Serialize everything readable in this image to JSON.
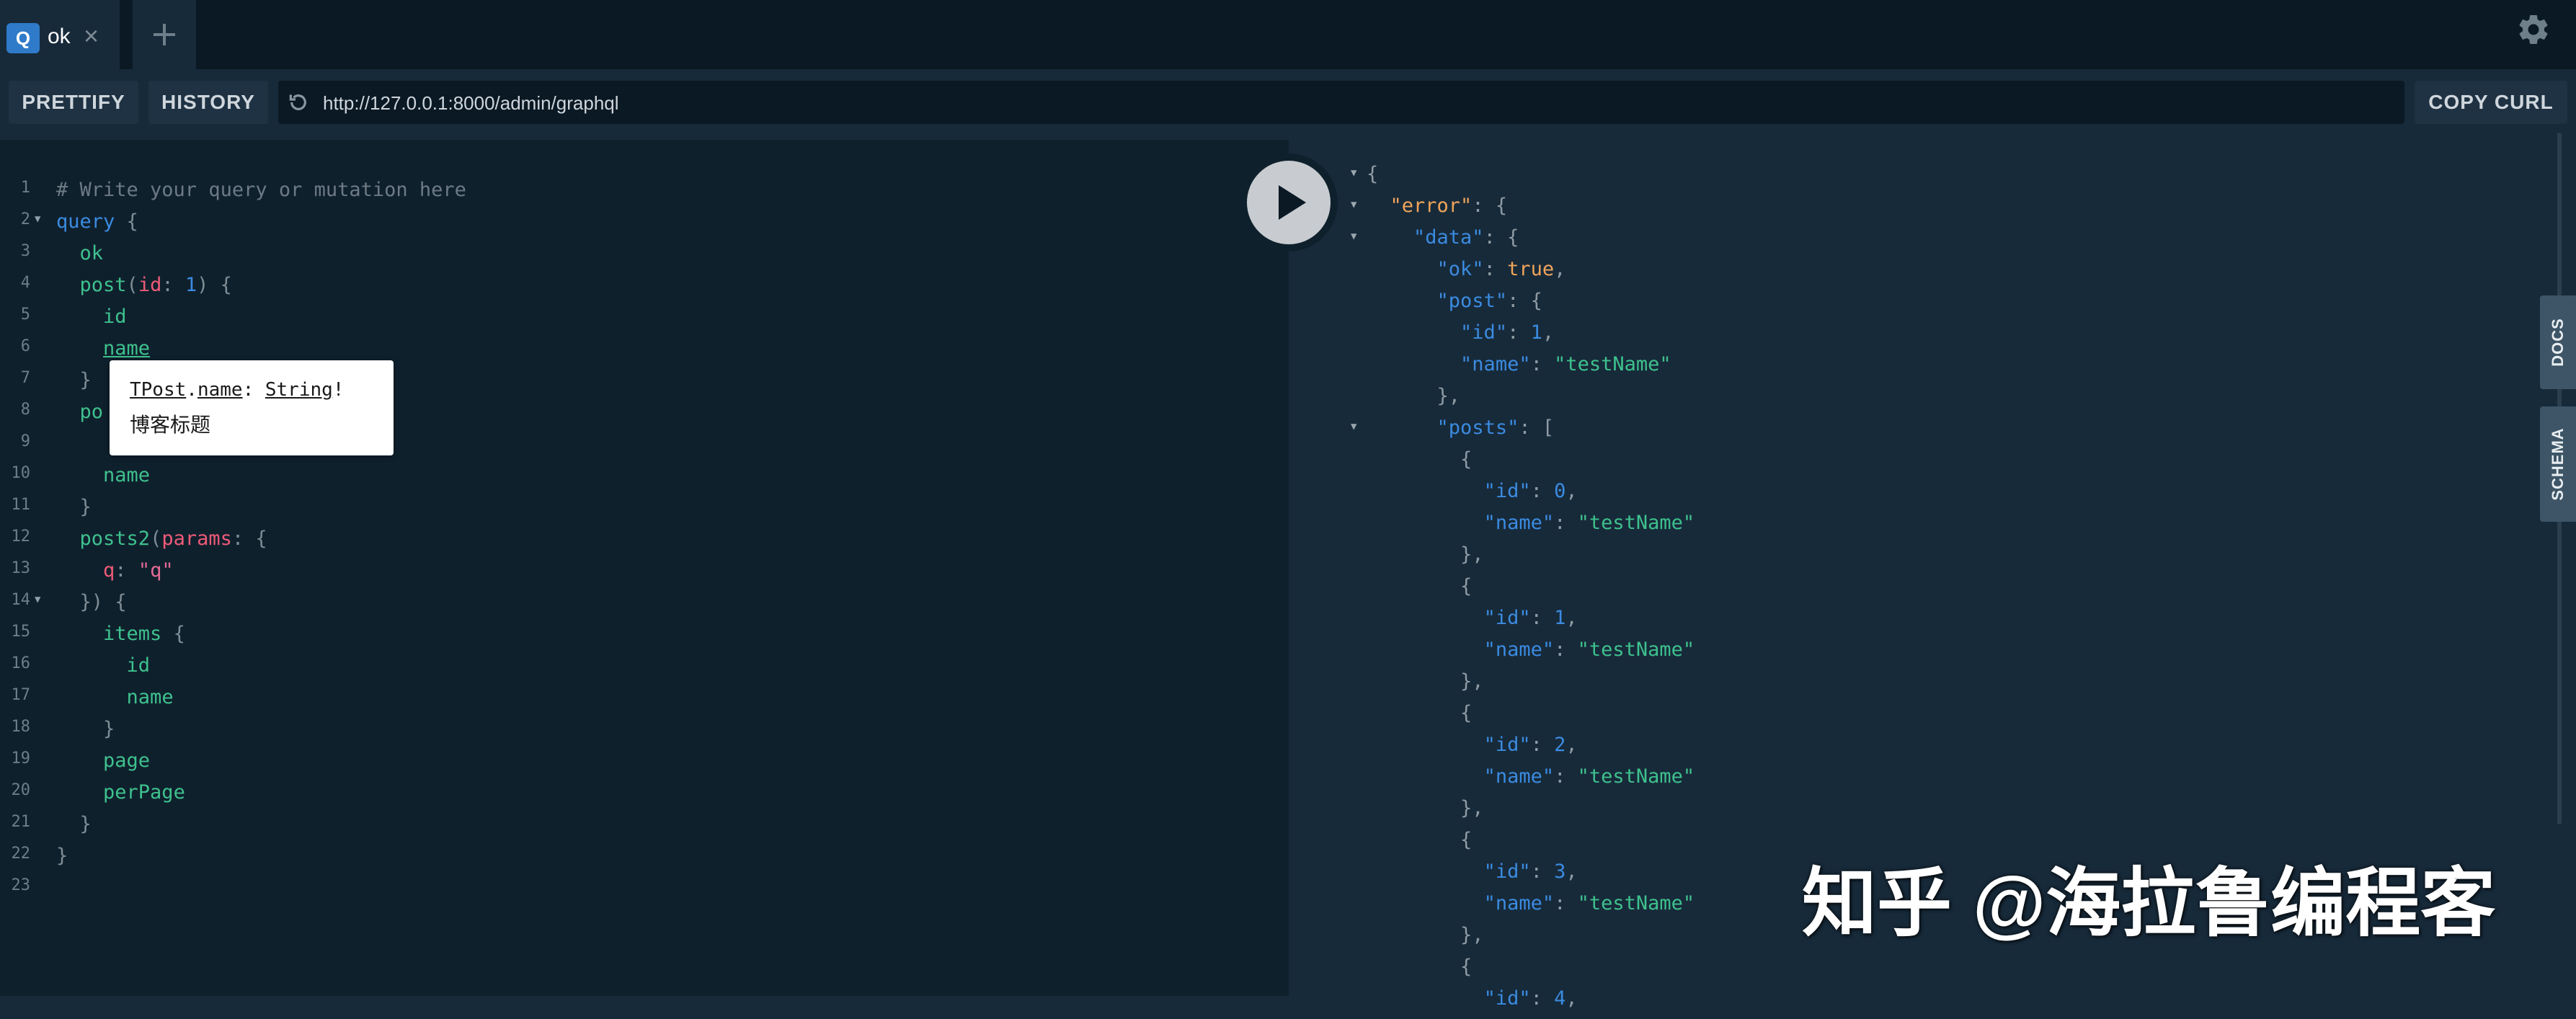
{
  "tabs": [
    {
      "badge": "Q",
      "name": "ok",
      "close": "×"
    }
  ],
  "toolbar": {
    "prettify": "PRETTIFY",
    "history": "HISTORY",
    "url": "http://127.0.0.1:8000/admin/graphql",
    "copy_curl": "COPY CURL"
  },
  "editor": {
    "lines": [
      {
        "n": "1",
        "fold": false,
        "code": "# Write your query or mutation here"
      },
      {
        "n": "2",
        "fold": true,
        "code": "query {"
      },
      {
        "n": "3",
        "fold": false,
        "code": "  ok"
      },
      {
        "n": "4",
        "fold": false,
        "code": "  post(id: 1) {"
      },
      {
        "n": "5",
        "fold": false,
        "code": "    id"
      },
      {
        "n": "6",
        "fold": false,
        "code": "    name"
      },
      {
        "n": "7",
        "fold": false,
        "code": "  }"
      },
      {
        "n": "8",
        "fold": false,
        "code": "  po"
      },
      {
        "n": "9",
        "fold": false,
        "code": ""
      },
      {
        "n": "10",
        "fold": false,
        "code": "    name"
      },
      {
        "n": "11",
        "fold": false,
        "code": "  }"
      },
      {
        "n": "12",
        "fold": false,
        "code": "  posts2(params: {"
      },
      {
        "n": "13",
        "fold": false,
        "code": "    q: \"q\""
      },
      {
        "n": "14",
        "fold": true,
        "code": "  }) {"
      },
      {
        "n": "15",
        "fold": false,
        "code": "    items {"
      },
      {
        "n": "16",
        "fold": false,
        "code": "      id"
      },
      {
        "n": "17",
        "fold": false,
        "code": "      name"
      },
      {
        "n": "18",
        "fold": false,
        "code": "    }"
      },
      {
        "n": "19",
        "fold": false,
        "code": "    page"
      },
      {
        "n": "20",
        "fold": false,
        "code": "    perPage"
      },
      {
        "n": "21",
        "fold": false,
        "code": "  }"
      },
      {
        "n": "22",
        "fold": false,
        "code": "}"
      },
      {
        "n": "23",
        "fold": false,
        "code": ""
      }
    ],
    "tooltip": {
      "type_name": "TPost",
      "field": "name",
      "field_type": "String",
      "suffix": "!",
      "description": "博客标题"
    }
  },
  "result": {
    "lines": [
      {
        "fold": true,
        "code": "{"
      },
      {
        "fold": true,
        "code": "  \"error\": {"
      },
      {
        "fold": true,
        "code": "    \"data\": {"
      },
      {
        "fold": false,
        "code": "      \"ok\": true,"
      },
      {
        "fold": false,
        "code": "      \"post\": {"
      },
      {
        "fold": false,
        "code": "        \"id\": 1,"
      },
      {
        "fold": false,
        "code": "        \"name\": \"testName\""
      },
      {
        "fold": false,
        "code": "      },"
      },
      {
        "fold": true,
        "code": "      \"posts\": ["
      },
      {
        "fold": false,
        "code": "        {"
      },
      {
        "fold": false,
        "code": "          \"id\": 0,"
      },
      {
        "fold": false,
        "code": "          \"name\": \"testName\""
      },
      {
        "fold": false,
        "code": "        },"
      },
      {
        "fold": false,
        "code": "        {"
      },
      {
        "fold": false,
        "code": "          \"id\": 1,"
      },
      {
        "fold": false,
        "code": "          \"name\": \"testName\""
      },
      {
        "fold": false,
        "code": "        },"
      },
      {
        "fold": false,
        "code": "        {"
      },
      {
        "fold": false,
        "code": "          \"id\": 2,"
      },
      {
        "fold": false,
        "code": "          \"name\": \"testName\""
      },
      {
        "fold": false,
        "code": "        },"
      },
      {
        "fold": false,
        "code": "        {"
      },
      {
        "fold": false,
        "code": "          \"id\": 3,"
      },
      {
        "fold": false,
        "code": "          \"name\": \"testName\""
      },
      {
        "fold": false,
        "code": "        },"
      },
      {
        "fold": false,
        "code": "        {"
      },
      {
        "fold": false,
        "code": "          \"id\": 4,"
      }
    ]
  },
  "side_tabs": {
    "docs": "DOCS",
    "schema": "SCHEMA"
  },
  "watermark": "知乎 @海拉鲁编程客",
  "colors": {
    "background": "#172a3a",
    "editor_bg": "#0f202d",
    "tab_bar": "#0b1924",
    "accent": "#2f7ac9"
  },
  "icons": {
    "tab_badge": "query-badge-icon",
    "add_tab": "plus-icon",
    "settings": "gear-icon",
    "reload": "reload-icon",
    "run": "play-icon"
  }
}
